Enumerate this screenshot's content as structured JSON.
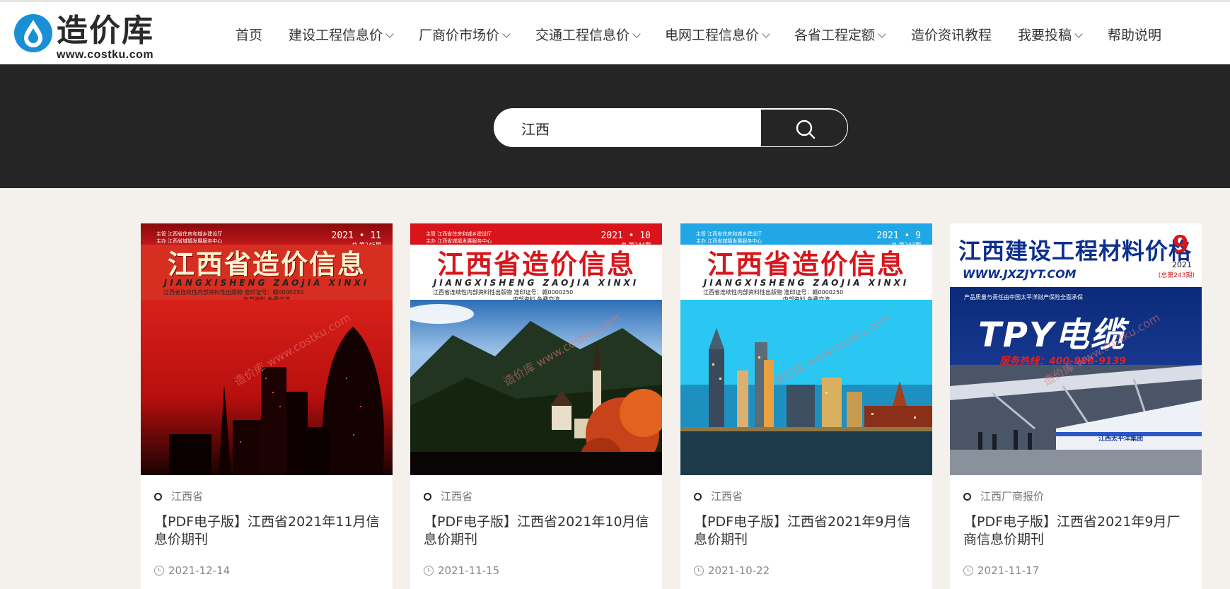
{
  "brand": {
    "name": "造价库",
    "url": "www.costku.com",
    "color": "#1a8fd6",
    "icon": "water-drop-logo-icon"
  },
  "nav": [
    {
      "label": "首页",
      "has_dropdown": false
    },
    {
      "label": "建设工程信息价",
      "has_dropdown": true
    },
    {
      "label": "厂商价市场价",
      "has_dropdown": true
    },
    {
      "label": "交通工程信息价",
      "has_dropdown": true
    },
    {
      "label": "电网工程信息价",
      "has_dropdown": true
    },
    {
      "label": "各省工程定额",
      "has_dropdown": true
    },
    {
      "label": "造价资讯教程",
      "has_dropdown": false
    },
    {
      "label": "我要投稿",
      "has_dropdown": true
    },
    {
      "label": "帮助说明",
      "has_dropdown": false
    }
  ],
  "search": {
    "value": "江西",
    "button_icon": "search-icon"
  },
  "cards": [
    {
      "category": "江西省",
      "title": "【PDF电子版】江西省2021年11月信息价期刊",
      "date": "2021-12-14",
      "cover": {
        "top_text": "主管 江西省住房和城乡建设厅\n主办 江西省城镇发展服务中心",
        "issue": "2021 • 11",
        "issue_sub": "总 第245期",
        "title": "江西省造价信息",
        "pinyin": "JIANGXISHENG ZAOJIA XINXI",
        "line": "江西省连续性内部资料性出版物    准印证号：赣0000250",
        "free": "内部资料  免费交流",
        "watermark": "造价库 www.costku.com",
        "head_color": "#b40c10",
        "scene": "red-city"
      }
    },
    {
      "category": "江西省",
      "title": "【PDF电子版】江西省2021年10月信息价期刊",
      "date": "2021-11-15",
      "cover": {
        "top_text": "主管 江西省住房和城乡建设厅\n主办 江西省城镇发展服务中心",
        "issue": "2021 • 10",
        "issue_sub": "总 第244期",
        "title": "江西省造价信息",
        "pinyin": "JIANGXISHENG ZAOJIA XINXI",
        "line": "江西省连续性内部资料性出版物    准印证号：赣0000250",
        "free": "内部资料  免费交流",
        "watermark": "造价库 www.costku.com",
        "head_color": "#d9141a",
        "scene": "mountain-village"
      }
    },
    {
      "category": "江西省",
      "title": "【PDF电子版】江西省2021年9月信息价期刊",
      "date": "2021-10-22",
      "cover": {
        "top_text": "主管 江西省住房和城乡建设厅\n主办 江西省城镇发展服务中心",
        "issue": "2021 • 9",
        "issue_sub": "总 第243期",
        "title": "江西省造价信息",
        "pinyin": "JIANGXISHENG ZAOJIA XINXI",
        "line": "江西省连续性内部资料性出版物    准印证号：赣0000250",
        "free": "内部资料  免费交流",
        "watermark": "造价库 www.costku.com",
        "head_color": "#22a7e6",
        "scene": "skyline"
      }
    },
    {
      "category": "江西厂商报价",
      "title": "【PDF电子版】江西省2021年9月厂商信息价期刊",
      "date": "2021-11-17",
      "cover": {
        "title": "江西建设工程材料价格",
        "issue": "9",
        "issue_sub": "2021",
        "issue_sub2": "(总第243期)",
        "site": "WWW.JXZJYT.COM",
        "tagline": "产品质量与责任由中国太平洋财产保险全面承保",
        "ad": "TPY电缆",
        "hotline": "服务热线：400-888-9139",
        "train_text": "江西太平洋集团",
        "watermark": "造价库 www.costku.com",
        "scene": "train-station"
      }
    }
  ]
}
